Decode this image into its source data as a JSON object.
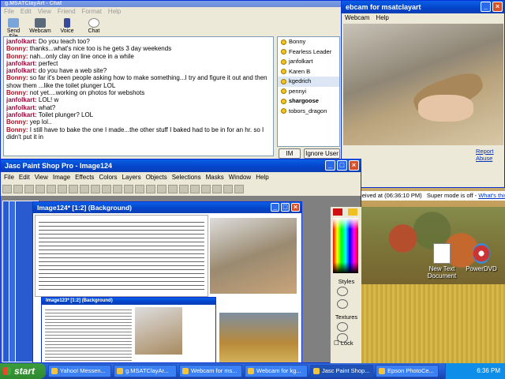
{
  "chat_window": {
    "title": "g.MSATClayArt - Chat",
    "menus": [
      "File",
      "Edit",
      "View",
      "Friend",
      "Format",
      "Help"
    ],
    "toolbar": [
      "Send File",
      "Webcam",
      "Voice",
      "Chat"
    ],
    "messages": [
      {
        "from": "janfolkart:",
        "text": " Do you teach too?",
        "cls": "j"
      },
      {
        "from": "Bonny:",
        "text": " thanks...what's nice too is he gets 3 day weekends",
        "cls": "b"
      },
      {
        "from": "Bonny:",
        "text": " nah...only clay on line once in a while",
        "cls": "b"
      },
      {
        "from": "janfolkart:",
        "text": " perfect",
        "cls": "j"
      },
      {
        "from": "janfolkart:",
        "text": " do you have a web site?",
        "cls": "j"
      },
      {
        "from": "Bonny:",
        "text": " so far it's been people asking how to make something...I try and figure it out and then show them ...like the toilet plunger LOL",
        "cls": "b"
      },
      {
        "from": "Bonny:",
        "text": " not yet....working on photos for webshots",
        "cls": "b"
      },
      {
        "from": "janfolkart:",
        "text": " LOL! w",
        "cls": "j"
      },
      {
        "from": "janfolkart:",
        "text": " what?",
        "cls": "j"
      },
      {
        "from": "janfolkart:",
        "text": " Toilet plunger? LOL",
        "cls": "j"
      },
      {
        "from": "Bonny:",
        "text": " yep lol..",
        "cls": "b"
      },
      {
        "from": "Bonny:",
        "text": " I still have to bake the one I made...the other stuff I baked had to be in for an hr. so I didn't put it in",
        "cls": "b"
      }
    ],
    "users": [
      "Bonny",
      "Fearless Leader",
      "janfolkart",
      "Karen B",
      "kgedrich",
      "pennyi",
      "shargoose",
      "tobors_dragon"
    ],
    "selected_user": "kgedrich",
    "im_button": "IM",
    "ignore_button": "Ignore User"
  },
  "webcam_window": {
    "title": "ebcam for msatclayart",
    "menus": [
      "Webcam",
      "Help"
    ],
    "report_link": "Report Abuse",
    "received": "ceived at (06:36:10 PM)",
    "super_mode": "Super mode is off - ",
    "whats_this": "What's this?"
  },
  "psp_window": {
    "title": "Jasc Paint Shop Pro - Image124",
    "menus": [
      "File",
      "Edit",
      "View",
      "Image",
      "Effects",
      "Colors",
      "Layers",
      "Objects",
      "Selections",
      "Masks",
      "Window",
      "Help"
    ],
    "image_title": "Image124* [1:2] (Background)",
    "nested_title": "Image123* [1:2] (Background)",
    "palette_labels": [
      "Styles",
      "Textures",
      "Lock"
    ]
  },
  "desktop_icons": [
    "New Text Document",
    "PowerDVD"
  ],
  "taskbar": {
    "start": "start",
    "tasks": [
      "Yahoo! Messen...",
      "g.MSATClayAr...",
      "Webcam for ms...",
      "Webcam for kg...",
      "Jasc Paint Shop...",
      "Epson PhotoCe..."
    ],
    "clock": "6:36 PM"
  }
}
